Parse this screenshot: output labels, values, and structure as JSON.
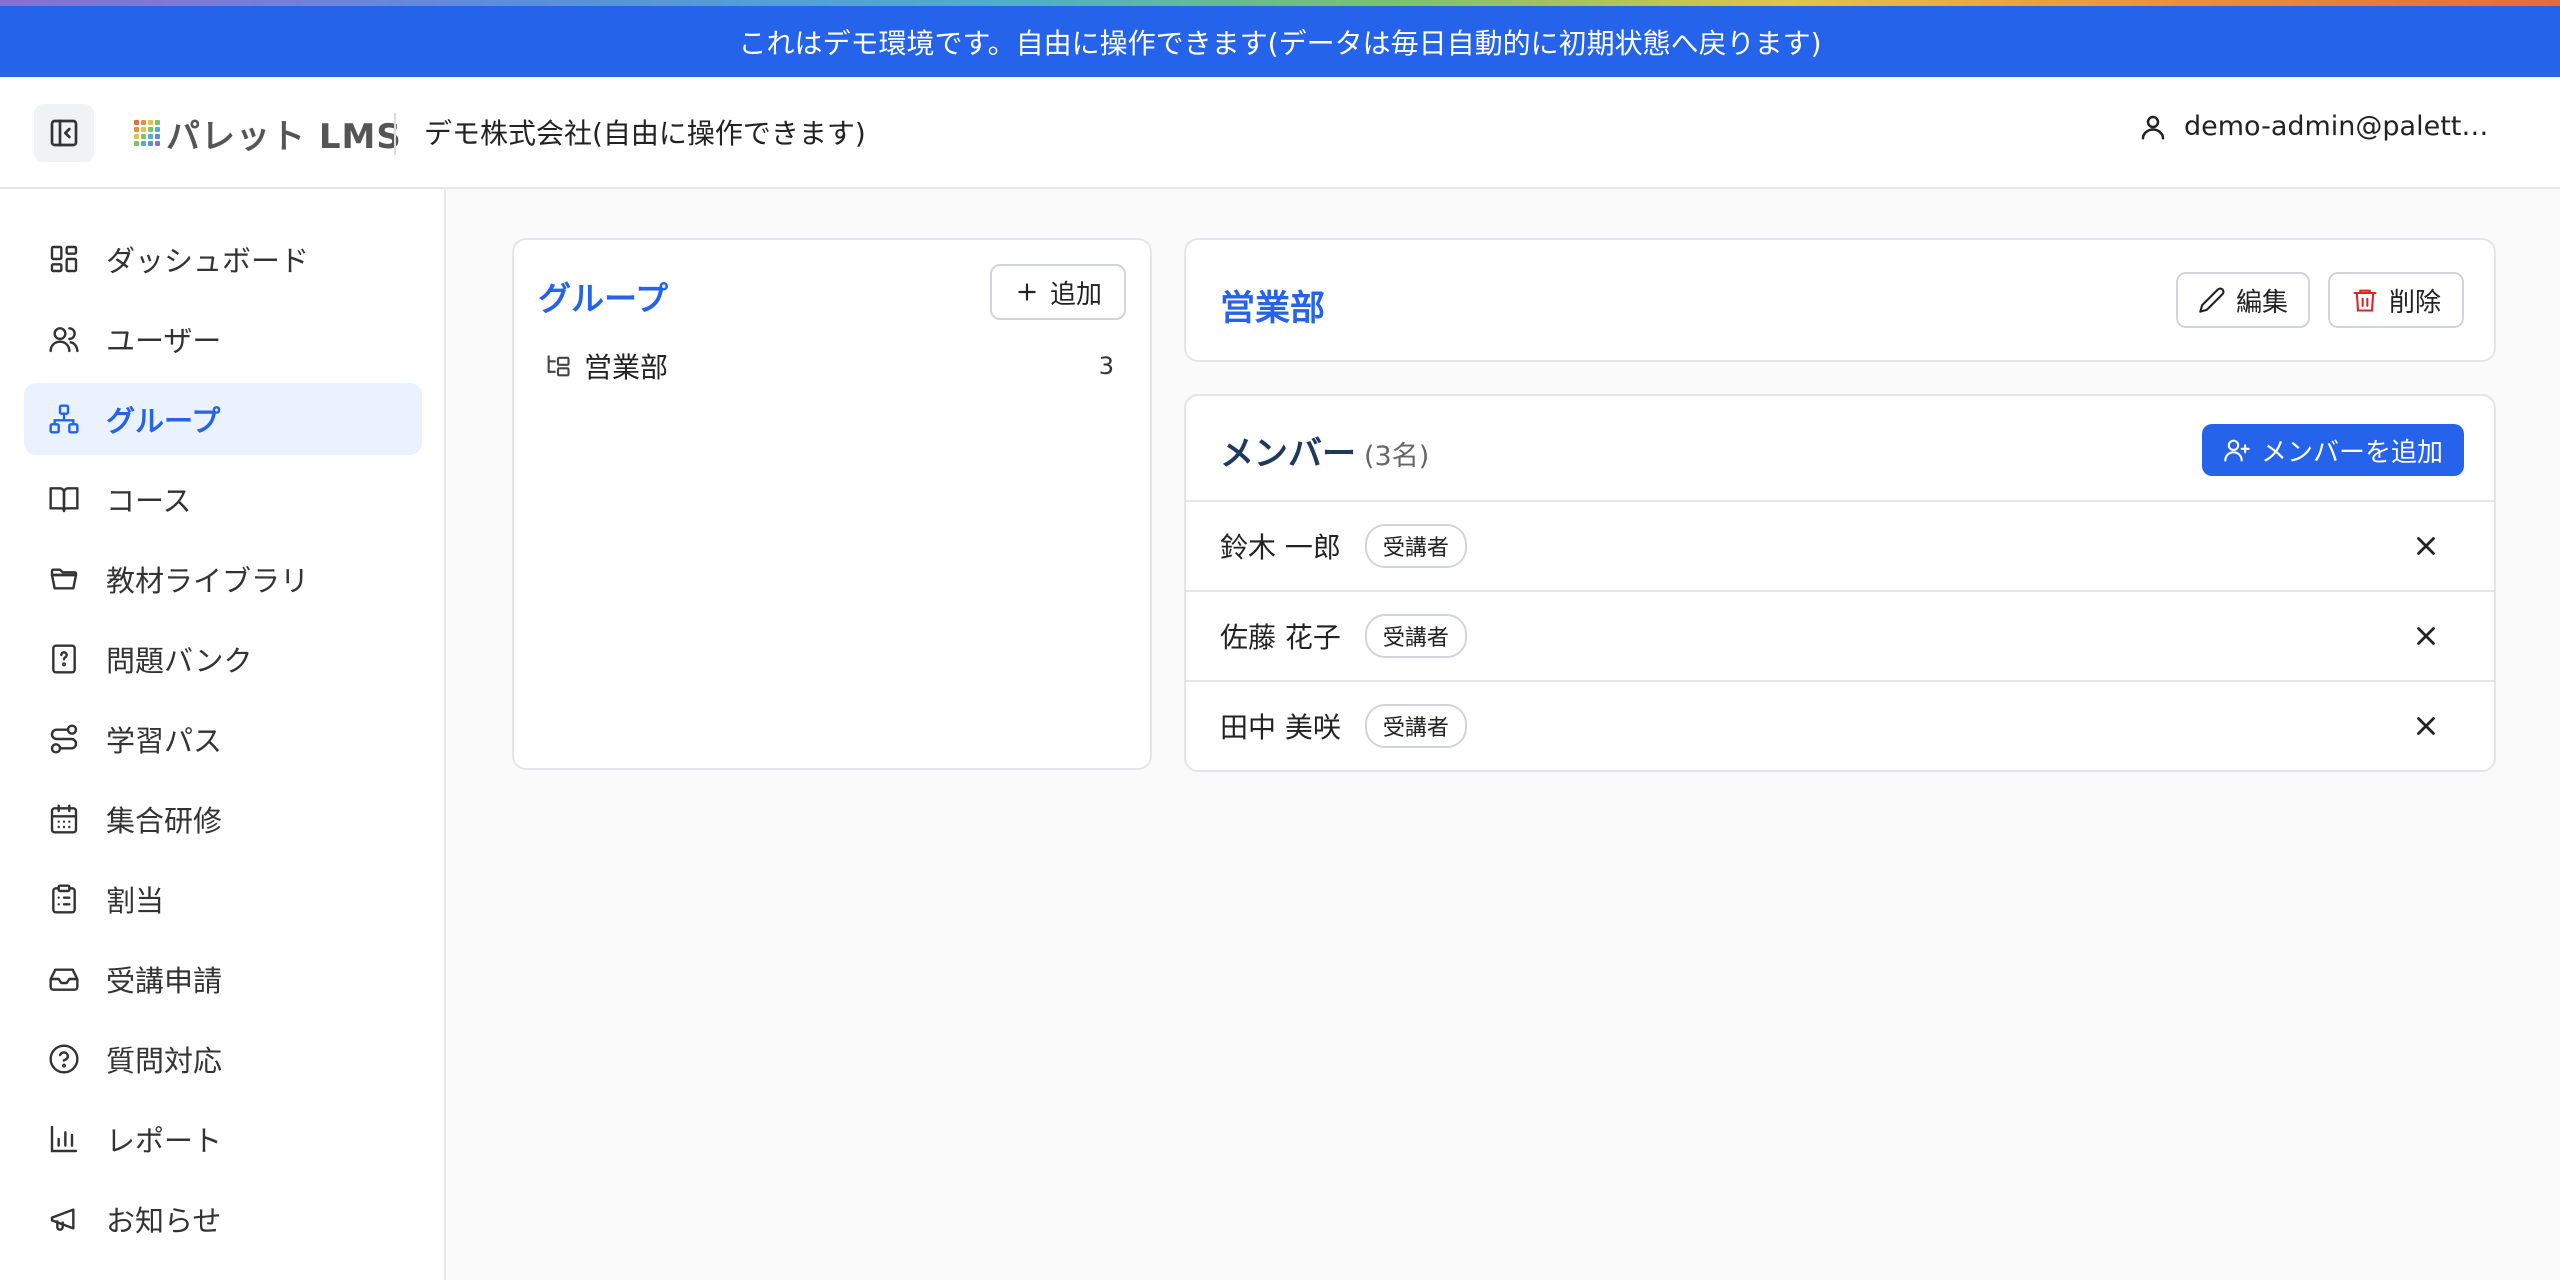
{
  "banner": {
    "text": "これはデモ環境です。自由に操作できます(データは毎日自動的に初期状態へ戻ります)"
  },
  "header": {
    "logo_text": "パレット LMS",
    "org_name": "デモ株式会社(自由に操作できます)",
    "user_email": "demo-admin@palette.e…"
  },
  "sidebar": {
    "items": [
      {
        "label": "ダッシュボード",
        "icon": "dashboard-icon"
      },
      {
        "label": "ユーザー",
        "icon": "users-icon"
      },
      {
        "label": "グループ",
        "icon": "network-icon",
        "active": true
      },
      {
        "label": "コース",
        "icon": "book-icon"
      },
      {
        "label": "教材ライブラリ",
        "icon": "folder-icon"
      },
      {
        "label": "問題バンク",
        "icon": "file-question-icon"
      },
      {
        "label": "学習パス",
        "icon": "route-icon"
      },
      {
        "label": "集合研修",
        "icon": "calendar-icon"
      },
      {
        "label": "割当",
        "icon": "clipboard-icon"
      },
      {
        "label": "受講申請",
        "icon": "inbox-icon"
      },
      {
        "label": "質問対応",
        "icon": "help-circle-icon"
      },
      {
        "label": "レポート",
        "icon": "bar-chart-icon"
      },
      {
        "label": "お知らせ",
        "icon": "megaphone-icon"
      }
    ]
  },
  "groups": {
    "title": "グループ",
    "add_label": "追加",
    "tree": [
      {
        "label": "営業部",
        "count": "3"
      }
    ]
  },
  "detail": {
    "title": "営業部",
    "edit_label": "編集",
    "delete_label": "削除"
  },
  "members": {
    "title": "メンバー",
    "count": "(3名)",
    "add_label": "メンバーを追加",
    "rows": [
      {
        "name": "鈴木 一郎",
        "role": "受講者"
      },
      {
        "name": "佐藤 花子",
        "role": "受講者"
      },
      {
        "name": "田中 美咲",
        "role": "受講者"
      }
    ]
  },
  "colors": {
    "accent": "#2563eb",
    "banner": "#2563eb",
    "active_bg": "#e9f2fe",
    "danger": "#dc2626"
  }
}
